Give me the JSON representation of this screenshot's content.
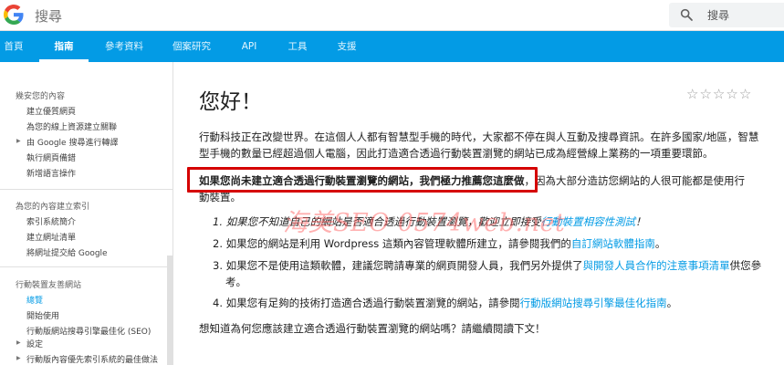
{
  "topbar": {
    "search_placeholder_left": "搜尋",
    "search_input_placeholder": "搜尋"
  },
  "nav": {
    "tabs": [
      {
        "label": "首頁"
      },
      {
        "label": "指南"
      },
      {
        "label": "參考資料"
      },
      {
        "label": "個案研究"
      },
      {
        "label": "API"
      },
      {
        "label": "工具"
      },
      {
        "label": "支援"
      }
    ]
  },
  "sidebar": {
    "sections": [
      {
        "heading": "幾安您的內容",
        "items": [
          "建立優質網頁",
          "為您的線上資源建立關聯",
          "由 Google 搜尋進行轉譯",
          "執行網頁備錯",
          "新增語言操作"
        ]
      },
      {
        "heading": "為您的內容建立索引",
        "items": [
          "索引系統簡介",
          "建立網址清單",
          "將網址提交給 Google"
        ]
      },
      {
        "heading": "行動裝置友善網站",
        "items": [
          "總覽",
          "開始使用",
          "行動版網站搜尋引擎最佳化 (SEO)",
          "設定",
          "行動版內容優先索引系統的最佳做法"
        ]
      }
    ]
  },
  "main": {
    "title": "您好！",
    "intro": "行動科技正在改變世界。在這個人人都有智慧型手機的時代，大家都不停在與人互動及搜尋資訊。在許多國家/地區，智慧型手機的數量已經超過個人電腦，因此打造適合透過行動裝置瀏覽的網站已成為經營線上業務的一項重要環節。",
    "highlight": "如果您尚未建立適合透過行動裝置瀏覽的網站，我們極力推薦您這麼做",
    "highlight_rest_line1": "，因為大部分造訪您網站的人很可能都是使用行",
    "highlight_rest_line2": "動裝置。",
    "list": [
      {
        "num": "1.",
        "text": "如果您不知道自己的網站是否適合透過行動裝置瀏覽，歡迎立即接受",
        "link": "行動裝置相容性測試",
        "after": "！"
      },
      {
        "num": "2.",
        "text": "如果您的網站是利用 Wordpress 這類內容管理軟體所建立，請參閱我們的",
        "link": "自訂網站軟體指南",
        "after": "。"
      },
      {
        "num": "3.",
        "text": "如果您不是使用這類軟體，建議您聘請專業的網頁開發人員，我們另外提供了",
        "link": "與開發人員合作的注意事項清單",
        "after": "供您參",
        "line2": "考。"
      },
      {
        "num": "4.",
        "text": "如果您有足夠的技術打造適合透過行動裝置瀏覽的網站，請參閱",
        "link": "行動版網站搜尋引擎最佳化指南",
        "after": "。"
      }
    ],
    "closing": "想知道為何您應該建立適合透過行動裝置瀏覽的網站嗎？請繼續閱讀下文！",
    "watermark": "海美SEO 0574web.net"
  },
  "rating": {
    "stars": [
      "☆",
      "☆",
      "☆",
      "☆",
      "☆"
    ]
  },
  "colors": {
    "nav_bg": "#039be5",
    "link": "#039be5",
    "highlight_border": "#d50000"
  }
}
